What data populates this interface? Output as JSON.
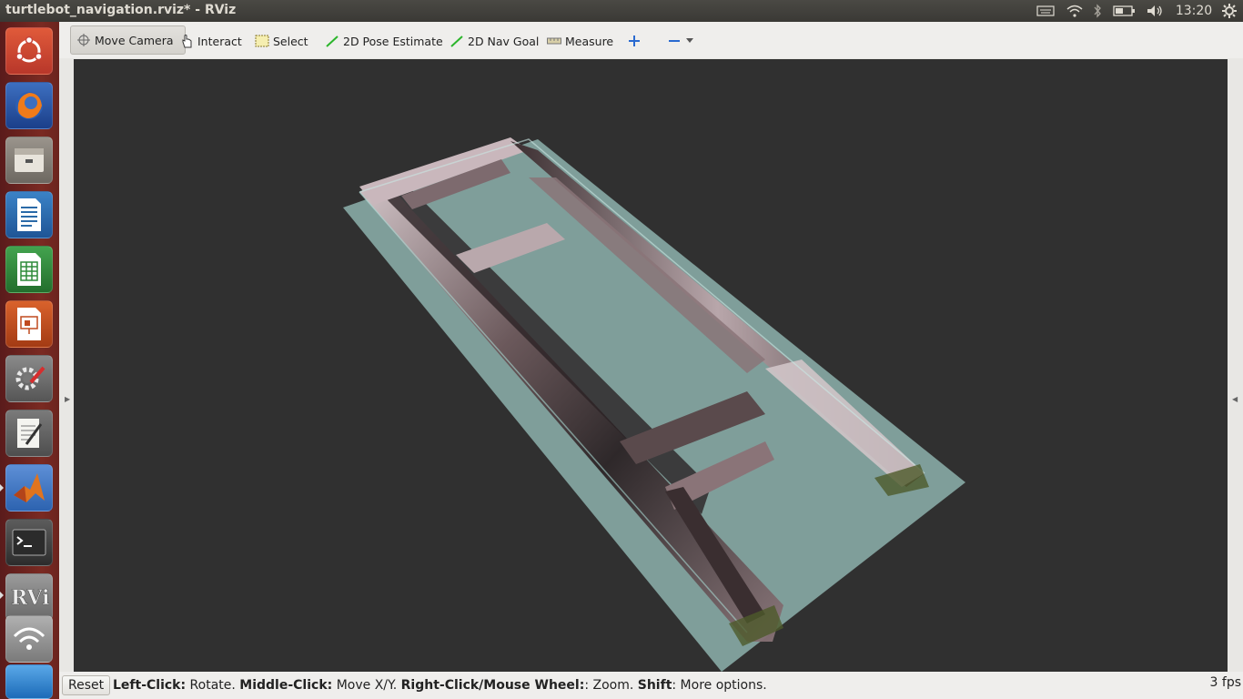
{
  "window": {
    "title": "turtlebot_navigation.rviz* - RViz"
  },
  "panel": {
    "time": "13:20",
    "icons": [
      "keyboard-icon",
      "wifi-icon",
      "bluetooth-icon",
      "battery-icon",
      "volume-icon",
      "settings-gear-icon"
    ]
  },
  "launcher": {
    "items": [
      {
        "name": "ubuntu-dash-icon",
        "color": "#c8453a"
      },
      {
        "name": "firefox-icon",
        "color": "#e66000"
      },
      {
        "name": "files-icon",
        "color": "#8a8580"
      },
      {
        "name": "libreoffice-writer-icon",
        "color": "#2a6aa8"
      },
      {
        "name": "libreoffice-calc-icon",
        "color": "#2e8b3a"
      },
      {
        "name": "libreoffice-impress-icon",
        "color": "#c04a1f"
      },
      {
        "name": "system-settings-icon",
        "color": "#7a7a7a"
      },
      {
        "name": "text-editor-icon",
        "color": "#6a6a6a"
      },
      {
        "name": "matlab-icon",
        "color": "#d9661a"
      },
      {
        "name": "terminal-icon",
        "color": "#2c2c2c"
      },
      {
        "name": "rviz-icon",
        "color": "#8a8a8a"
      },
      {
        "name": "network-icon",
        "color": "#9a9a9a"
      },
      {
        "name": "workspace-icon",
        "color": "#3a8ad0"
      }
    ]
  },
  "toolbar": {
    "move_camera": "Move Camera",
    "interact": "Interact",
    "select": "Select",
    "pose_estimate": "2D Pose Estimate",
    "nav_goal": "2D Nav Goal",
    "measure": "Measure"
  },
  "status": {
    "reset": "Reset",
    "h1": "Left-Click:",
    "t1": " Rotate. ",
    "h2": "Middle-Click:",
    "t2": " Move X/Y. ",
    "h3": "Right-Click/Mouse Wheel:",
    "t3": ": Zoom. ",
    "h4": "Shift",
    "t4": ": More options.",
    "fps": "3 fps"
  },
  "colors": {
    "viewport_bg": "#303030",
    "floor": "#7f9e9a",
    "launcher": "#6b241e"
  }
}
